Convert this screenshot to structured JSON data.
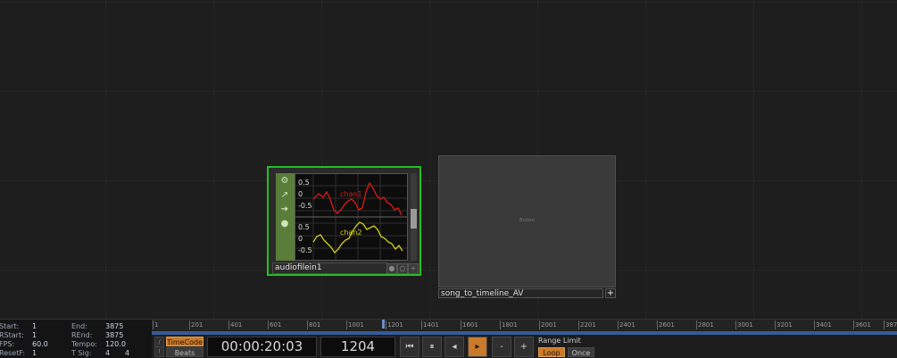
{
  "nodes": {
    "audio": {
      "name": "audiofilein1",
      "graph": {
        "chan1_label": "chan1",
        "chan2_label": "chan2",
        "ticks_top": [
          "0.5",
          "0",
          "-0.5"
        ],
        "ticks_bottom": [
          "0.5",
          "0",
          "-0.5"
        ],
        "chan1_color": "#e01818",
        "chan2_color": "#d8d018"
      },
      "side_icons": [
        "gear-icon",
        "graph-icon",
        "arrow-right-icon",
        "person-icon"
      ],
      "flags": [
        "●",
        "○",
        "+"
      ]
    },
    "button": {
      "view_label": "Button",
      "name": "song_to_timeline_AV",
      "plus": "+"
    }
  },
  "timeline": {
    "info": {
      "start_label": "Start:",
      "start": "1",
      "rstart_label": "RStart:",
      "rstart": "1",
      "fps_label": "FPS:",
      "fps": "60.0",
      "resetf_label": "ResetF:",
      "resetf": "1",
      "end_label": "End:",
      "end": "3875",
      "rend_label": "REnd:",
      "rend": "3875",
      "tempo_label": "Tempo:",
      "tempo": "120.0",
      "tsig_label": "T Sig:",
      "tsig_num": "4",
      "tsig_den": "4"
    },
    "ruler_ticks": [
      "1",
      "201",
      "401",
      "601",
      "801",
      "1001",
      "1201",
      "1401",
      "1601",
      "1801",
      "2001",
      "2201",
      "2401",
      "2601",
      "2801",
      "3001",
      "3201",
      "3401",
      "3601",
      "387"
    ],
    "timecode_label": "TimeCode",
    "beats_label": "Beats",
    "timecode": "00:00:20:03",
    "frame": "1204",
    "transport": {
      "rewind": "⏮",
      "pause": "⏸",
      "step_back": "◂",
      "play": "▸",
      "minus": "-",
      "plus": "+"
    },
    "range_limit_label": "Range Limit",
    "loop_label": "Loop",
    "once_label": "Once",
    "accent": "#c97a2b"
  }
}
